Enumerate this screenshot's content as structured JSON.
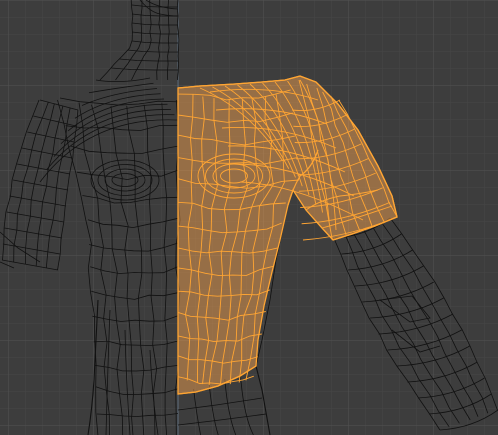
{
  "viewport": {
    "mode": "edit-mode",
    "view": "front-orthographic",
    "shading": "wireframe",
    "background_color": "#3d3d3d",
    "grid_minor_color": "#474747",
    "grid_major_color": "#525252",
    "axis_line_color": "#6e8aa6",
    "wire_unselected_color": "#111111",
    "wire_selected_color": "#ffa533",
    "face_selected_color": "#f0a050",
    "face_selected_opacity": 0.5
  },
  "mesh": {
    "object": "human-body-mesh",
    "symmetry": "mirror-x",
    "selection": "right-torso-and-upper-arm"
  }
}
